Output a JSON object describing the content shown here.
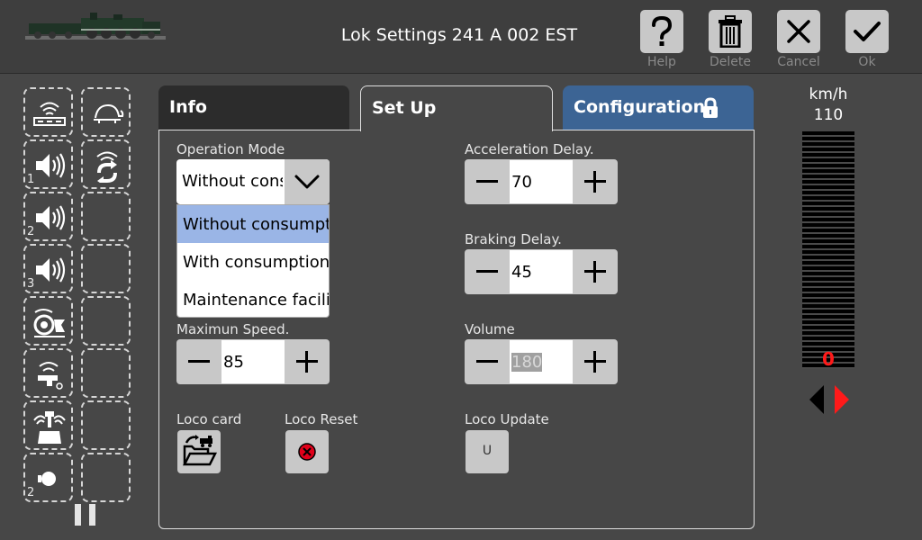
{
  "header": {
    "title": "Lok Settings 241 A 002 EST",
    "buttons": [
      {
        "label": "Help",
        "icon": "question-icon"
      },
      {
        "label": "Delete",
        "icon": "trash-icon"
      },
      {
        "label": "Cancel",
        "icon": "close-icon"
      },
      {
        "label": "Ok",
        "icon": "check-icon"
      }
    ]
  },
  "functions": {
    "left": [
      {
        "icon": "sound-router-icon",
        "number": ""
      },
      {
        "icon": "speaker-icon",
        "number": "1"
      },
      {
        "icon": "speaker-icon",
        "number": "2"
      },
      {
        "icon": "speaker-icon",
        "number": "3"
      },
      {
        "icon": "compressor-icon",
        "number": ""
      },
      {
        "icon": "whistle-icon",
        "number": ""
      },
      {
        "icon": "steam-dome-icon",
        "number": ""
      },
      {
        "icon": "headlight-icon",
        "number": "2"
      }
    ],
    "right": [
      {
        "icon": "turtle-icon"
      },
      {
        "icon": "sound-cycle-icon"
      }
    ]
  },
  "tabs": {
    "info": "Info",
    "setup": "Set Up",
    "config": "Configuration"
  },
  "operation_mode": {
    "label": "Operation Mode",
    "value": "Without consumption",
    "options": [
      "Without consumption",
      "With consumption",
      "Maintenance facility"
    ]
  },
  "max_speed": {
    "label": "Maximun Speed.",
    "value": "85"
  },
  "acceleration": {
    "label": "Acceleration Delay.",
    "value": "70"
  },
  "braking": {
    "label": "Braking Delay.",
    "value": "45"
  },
  "volume": {
    "label": "Volume",
    "value": "180"
  },
  "loco_card": {
    "label": "Loco card"
  },
  "loco_reset": {
    "label": "Loco Reset"
  },
  "loco_update": {
    "label": "Loco Update",
    "button": "U"
  },
  "speed": {
    "unit": "km/h",
    "max": "110",
    "current": "0"
  },
  "colors": {
    "accent_blue": "#3c6494",
    "selected_option": "#9ab5e6",
    "speed_red": "#ff1a1a"
  }
}
